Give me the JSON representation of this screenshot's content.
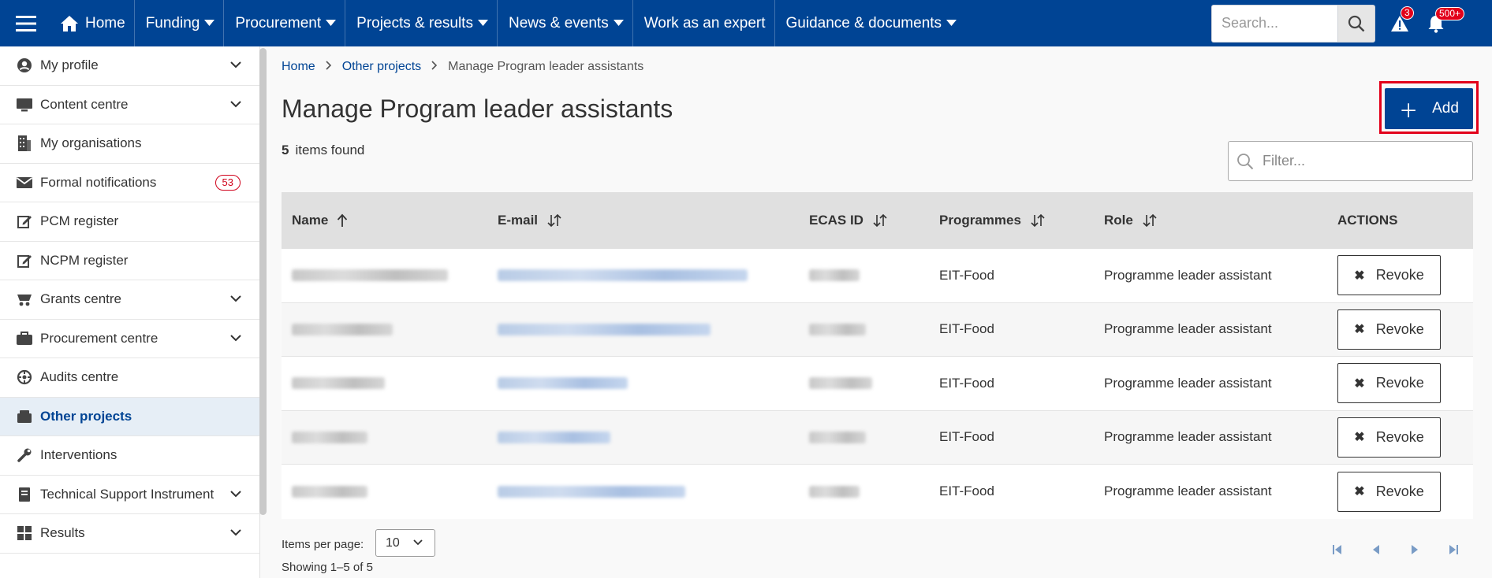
{
  "topnav": {
    "items": [
      {
        "label": "Home",
        "icon": "home-icon"
      },
      {
        "label": "Funding",
        "dropdown": true
      },
      {
        "label": "Procurement",
        "dropdown": true
      },
      {
        "label": "Projects & results",
        "dropdown": true
      },
      {
        "label": "News & events",
        "dropdown": true
      },
      {
        "label": "Work as an expert",
        "dropdown": false
      },
      {
        "label": "Guidance & documents",
        "dropdown": true
      }
    ],
    "search_placeholder": "Search...",
    "alerts_count": "3",
    "notifications_count": "500+"
  },
  "sidebar": {
    "items": [
      {
        "label": "My profile",
        "icon": "user-circle-icon",
        "expandable": true
      },
      {
        "label": "Content centre",
        "icon": "monitor-icon",
        "expandable": true
      },
      {
        "label": "My organisations",
        "icon": "building-icon",
        "expandable": false
      },
      {
        "label": "Formal notifications",
        "icon": "envelope-icon",
        "count": "53"
      },
      {
        "label": "PCM register",
        "icon": "edit-icon",
        "expandable": false
      },
      {
        "label": "NCPM register",
        "icon": "edit-icon",
        "expandable": false
      },
      {
        "label": "Grants centre",
        "icon": "grants-icon",
        "expandable": true
      },
      {
        "label": "Procurement centre",
        "icon": "briefcase-icon",
        "expandable": true
      },
      {
        "label": "Audits centre",
        "icon": "crosshair-icon",
        "expandable": false
      },
      {
        "label": "Other projects",
        "icon": "folder-icon",
        "active": true
      },
      {
        "label": "Interventions",
        "icon": "wrench-icon",
        "expandable": false
      },
      {
        "label": "Technical Support Instrument",
        "icon": "book-icon",
        "expandable": true
      },
      {
        "label": "Results",
        "icon": "grid-icon",
        "expandable": true
      }
    ]
  },
  "breadcrumb": {
    "home": "Home",
    "parent": "Other projects",
    "current": "Manage Program leader assistants"
  },
  "page": {
    "title": "Manage Program leader assistants",
    "items_count": "5",
    "items_found_label": "items found",
    "add_label": "Add",
    "filter_placeholder": "Filter..."
  },
  "table": {
    "columns": [
      "Name",
      "E-mail",
      "ECAS ID",
      "Programmes",
      "Role",
      "ACTIONS"
    ],
    "rows": [
      {
        "programme": "EIT-Food",
        "role": "Programme leader assistant",
        "action": "Revoke"
      },
      {
        "programme": "EIT-Food",
        "role": "Programme leader assistant",
        "action": "Revoke"
      },
      {
        "programme": "EIT-Food",
        "role": "Programme leader assistant",
        "action": "Revoke"
      },
      {
        "programme": "EIT-Food",
        "role": "Programme leader assistant",
        "action": "Revoke"
      },
      {
        "programme": "EIT-Food",
        "role": "Programme leader assistant",
        "action": "Revoke"
      }
    ]
  },
  "pagination": {
    "items_per_page_label": "Items per page:",
    "items_per_page": "10",
    "showing": "Showing 1–5 of 5"
  },
  "colors": {
    "brand": "#004494",
    "alert": "#e2001a"
  }
}
